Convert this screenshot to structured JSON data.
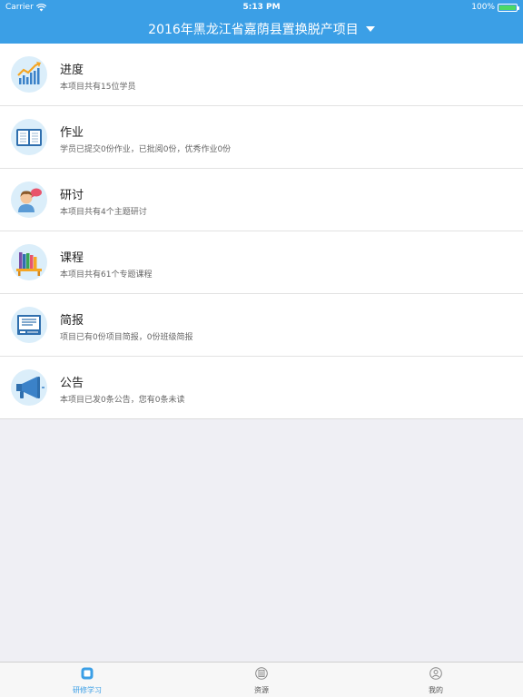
{
  "status_bar": {
    "carrier": "Carrier",
    "time": "5:13 PM",
    "battery": "100%"
  },
  "header": {
    "title": "2016年黑龙江省嘉荫县置换脱产项目"
  },
  "items": [
    {
      "icon": "chart-icon",
      "title": "进度",
      "subtitle": "本项目共有15位学员"
    },
    {
      "icon": "book-icon",
      "title": "作业",
      "subtitle": "学员已提交0份作业，已批阅0份，优秀作业0份"
    },
    {
      "icon": "discussion-icon",
      "title": "研讨",
      "subtitle": "本项目共有4个主题研讨"
    },
    {
      "icon": "bookshelf-icon",
      "title": "课程",
      "subtitle": "本项目共有61个专题课程"
    },
    {
      "icon": "newsletter-icon",
      "title": "简报",
      "subtitle": "项目已有0份项目简报，0份班级简报"
    },
    {
      "icon": "megaphone-icon",
      "title": "公告",
      "subtitle": "本项目已发0条公告，您有0条未读"
    }
  ],
  "tabbar": {
    "tabs": [
      {
        "label": "研修学习",
        "active": true
      },
      {
        "label": "资源",
        "active": false
      },
      {
        "label": "我的",
        "active": false
      }
    ]
  },
  "colors": {
    "header": "#3b9fe6",
    "accent": "#3b9fe6",
    "icon_bg": "#dbeefa",
    "battery": "#4cd964"
  }
}
